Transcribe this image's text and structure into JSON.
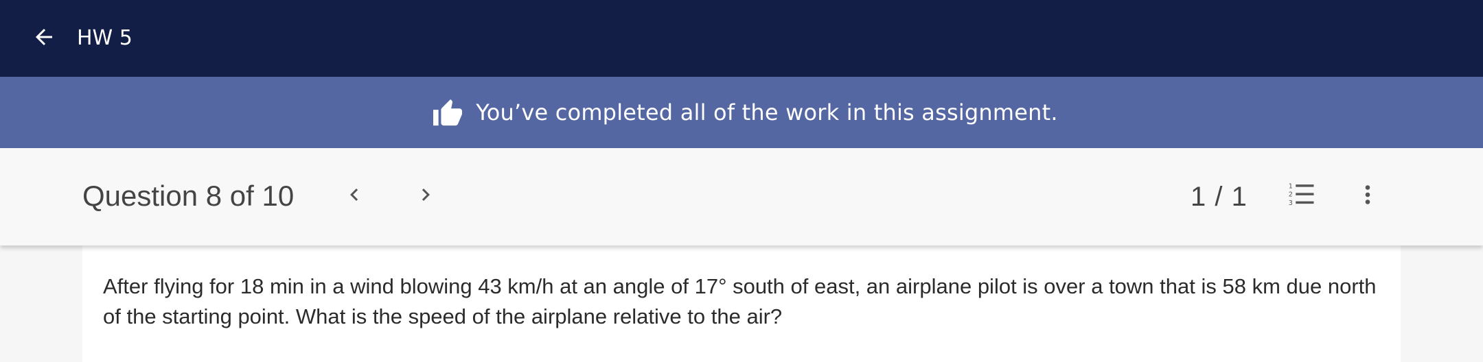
{
  "header": {
    "title": "HW 5",
    "back_icon": "arrow-left-icon"
  },
  "banner": {
    "message": "You’ve completed all of the work in this assignment.",
    "icon": "thumbs-up-icon"
  },
  "question_bar": {
    "title": "Question 8 of 10",
    "prev_icon": "chevron-left-icon",
    "next_icon": "chevron-right-icon",
    "page_count": "1 / 1",
    "list_icon": "numbered-list-icon",
    "more_icon": "more-vertical-icon"
  },
  "question": {
    "text": "After flying for 18 min in a wind blowing 43 km/h at an angle of 17° south of east, an airplane pilot is over a town that is 58 km due north of the starting point. What is the speed of the airplane relative to the air?"
  },
  "colors": {
    "header_bg": "#131e47",
    "banner_bg": "#5567a2",
    "bar_bg": "#f8f8f8"
  }
}
